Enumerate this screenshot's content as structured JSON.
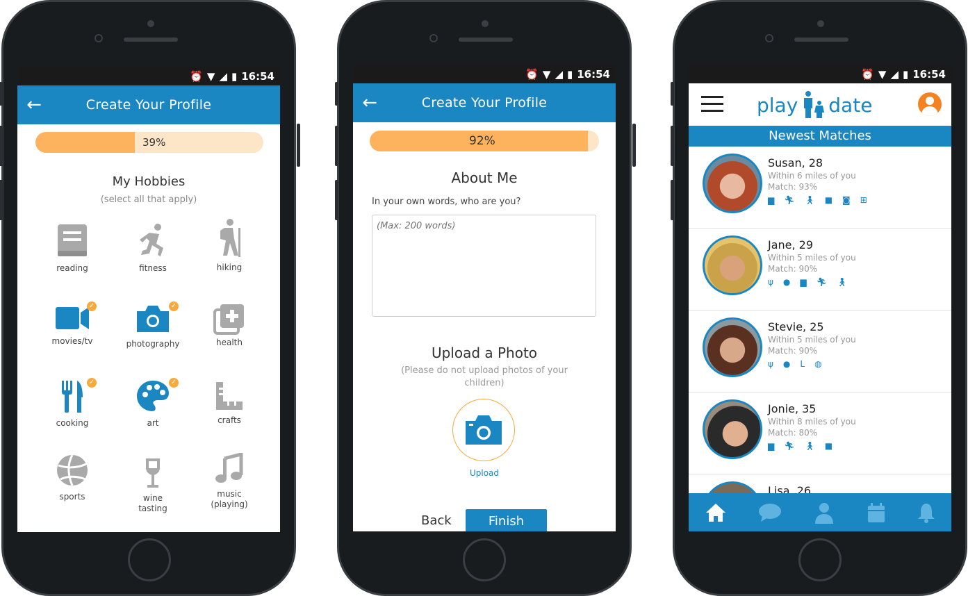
{
  "status_time": "16:54",
  "screen1": {
    "title": "Create Your Profile",
    "progress_label": "39%",
    "progress_value": 39,
    "heading": "My Hobbies",
    "subheading": "(select all that apply)",
    "hobbies": [
      {
        "label": "reading",
        "selected": false
      },
      {
        "label": "fitness",
        "selected": false
      },
      {
        "label": "hiking",
        "selected": false
      },
      {
        "label": "movies/tv",
        "selected": true
      },
      {
        "label": "photography",
        "selected": true
      },
      {
        "label": "health",
        "selected": false
      },
      {
        "label": "cooking",
        "selected": true
      },
      {
        "label": "art",
        "selected": true
      },
      {
        "label": "crafts",
        "selected": false
      },
      {
        "label": "sports",
        "selected": false
      },
      {
        "label": "wine tasting",
        "selected": false
      },
      {
        "label": "music (playing)",
        "selected": false
      }
    ]
  },
  "screen2": {
    "title": "Create Your Profile",
    "progress_label": "92%",
    "progress_value": 92,
    "about_heading": "About Me",
    "about_prompt": "In your own words, who are you?",
    "about_placeholder": "(Max: 200 words)",
    "upload_heading": "Upload a Photo",
    "upload_note": "(Please do not upload photos of your children)",
    "upload_label": "Upload",
    "back_label": "Back",
    "finish_label": "Finish"
  },
  "screen3": {
    "logo_left": "play",
    "logo_right": "date",
    "section_title": "Newest Matches",
    "matches": [
      {
        "name": "Susan, 28",
        "distance": "Within 6 miles of you",
        "match": "Match: 93%"
      },
      {
        "name": "Jane, 29",
        "distance": "Within 5 miles of you",
        "match": "Match: 90%"
      },
      {
        "name": "Stevie, 25",
        "distance": "Within 5 miles of you",
        "match": "Match: 90%"
      },
      {
        "name": "Jonie, 35",
        "distance": "Within 8 miles of you",
        "match": "Match: 80%"
      },
      {
        "name": "Lisa, 26",
        "distance": "",
        "match": ""
      }
    ]
  },
  "colors": {
    "primary": "#1a87c2",
    "progress_fill": "#fdb35e",
    "progress_track": "#fde6c8",
    "check": "#f8a93b",
    "icon_inactive": "#a9a9a9"
  }
}
